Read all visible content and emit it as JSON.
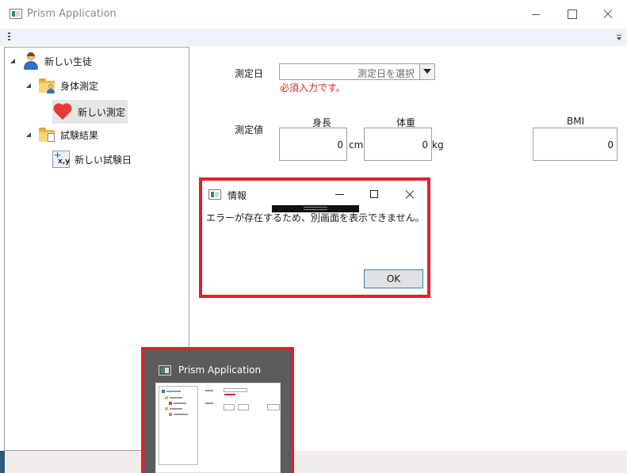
{
  "window": {
    "title": "Prism Application"
  },
  "tree": {
    "items": [
      {
        "label": "新しい生徒",
        "icon": "student-user-icon"
      },
      {
        "label": "身体測定",
        "icon": "folder-user-icon"
      },
      {
        "label": "新しい測定",
        "icon": "heart-icon"
      },
      {
        "label": "試験結果",
        "icon": "folder-document-icon"
      },
      {
        "label": "新しい試験日",
        "icon": "xy-chart-add-icon"
      }
    ]
  },
  "form": {
    "date_label": "測定日",
    "date_placeholder": "測定日を選択",
    "date_error": "必須入力です。",
    "measure_label": "測定値",
    "height_header": "身長",
    "weight_header": "体重",
    "bmi_header": "BMI",
    "height_value": "0",
    "height_unit": "cm",
    "weight_value": "0",
    "weight_unit": "kg",
    "bmi_value": "0"
  },
  "dialog": {
    "title": "情報",
    "message": "エラーが存在するため、別画面を表示できません。",
    "ok_label": "OK"
  },
  "thumbnail": {
    "title": "Prism Application"
  },
  "colors": {
    "highlight_border": "#e2202a",
    "error_text": "#e0201f",
    "toolbar_bg": "#eef3fa",
    "thumbnail_bg": "#5b5b5b"
  }
}
